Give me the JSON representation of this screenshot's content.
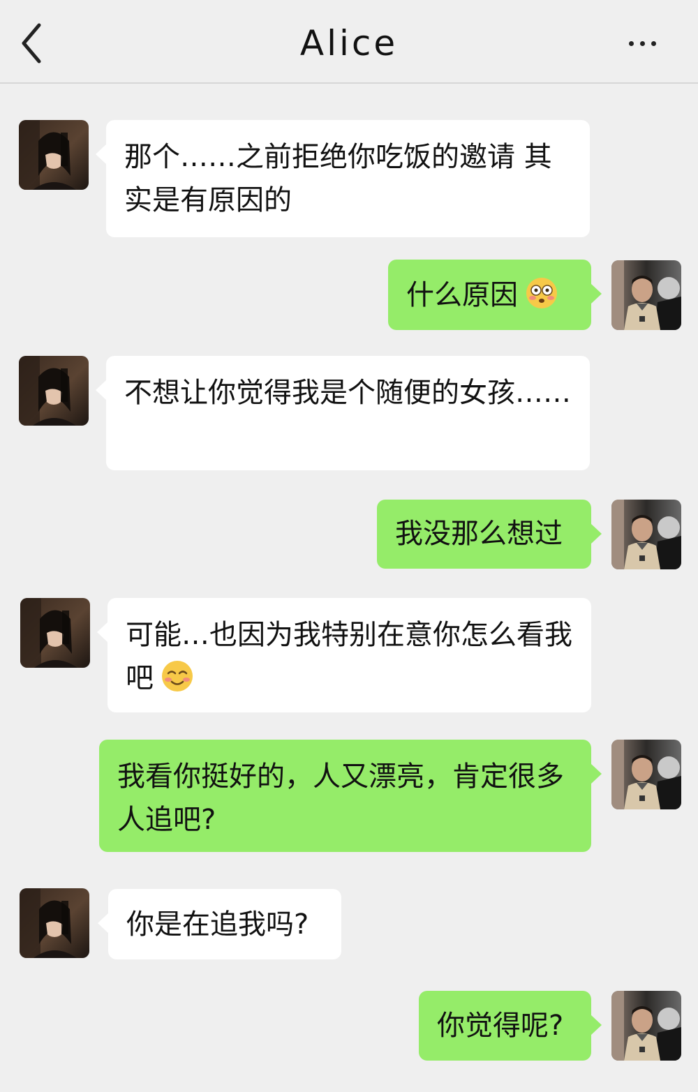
{
  "header": {
    "title": "Alice"
  },
  "icons": {
    "back": "chevron-left-icon",
    "more": "more-icon",
    "emoji_flushed": "flushed-face-icon",
    "emoji_smiling": "smiling-face-icon"
  },
  "colors": {
    "incoming_bubble": "#ffffff",
    "outgoing_bubble": "#95ec69",
    "background": "#efefef"
  },
  "messages": [
    {
      "sender": "Alice",
      "text": "那个……之前拒绝你吃饭的邀请 其实是有原因的"
    },
    {
      "sender": "me",
      "text": "什么原因",
      "emoji": "flushed-face"
    },
    {
      "sender": "Alice",
      "text": "不想让你觉得我是个随便的女孩……"
    },
    {
      "sender": "me",
      "text": "我没那么想过"
    },
    {
      "sender": "Alice",
      "text": "可能…也因为我特别在意你怎么看我吧",
      "emoji": "smiling-face"
    },
    {
      "sender": "me",
      "text": "我看你挺好的，人又漂亮，肯定很多人追吧?"
    },
    {
      "sender": "Alice",
      "text": "你是在追我吗?"
    },
    {
      "sender": "me",
      "text": "你觉得呢?"
    }
  ]
}
